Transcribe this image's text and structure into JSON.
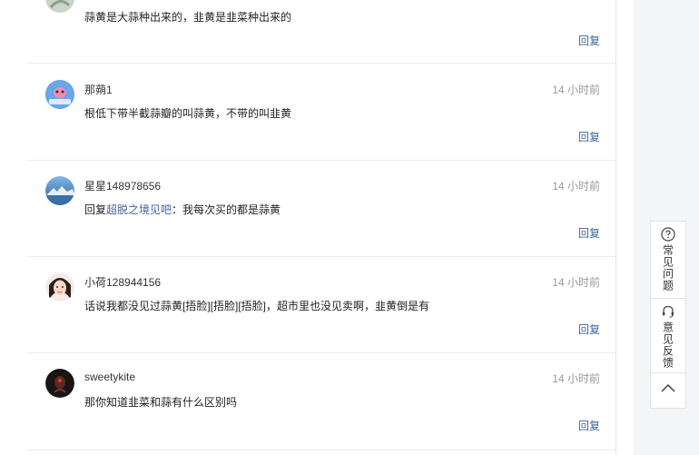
{
  "comments": [
    {
      "user": "",
      "time": "",
      "text": "蒜黄是大蒜种出来的，韭黄是韭菜种出来的",
      "reply_label": "回复"
    },
    {
      "user": "那蒴1",
      "time": "14 小时前",
      "text": "根低下带半截蒜瓣的叫蒜黄，不带的叫韭黄",
      "reply_label": "回复"
    },
    {
      "user": "星星148978656",
      "time": "14 小时前",
      "text_prefix": "回复",
      "text_mention": "超脱之境见吧",
      "text_rest": "：我每次买的都是蒜黄",
      "reply_label": "回复"
    },
    {
      "user": "小荷128944156",
      "time": "14 小时前",
      "text": "话说我都没见过蒜黄[捂脸][捂脸][捂脸]，超市里也没见卖啊，韭黄倒是有",
      "reply_label": "回复"
    },
    {
      "user": "sweetykite",
      "time": "14 小时前",
      "text": "那你知道韭菜和蒜有什么区别吗",
      "reply_label": "回复"
    }
  ],
  "sidebar": {
    "faq_label": "常见问题",
    "feedback_label": "意见反馈"
  },
  "colors": {
    "link": "#406599",
    "time": "#999999",
    "divider": "#ebebeb"
  }
}
